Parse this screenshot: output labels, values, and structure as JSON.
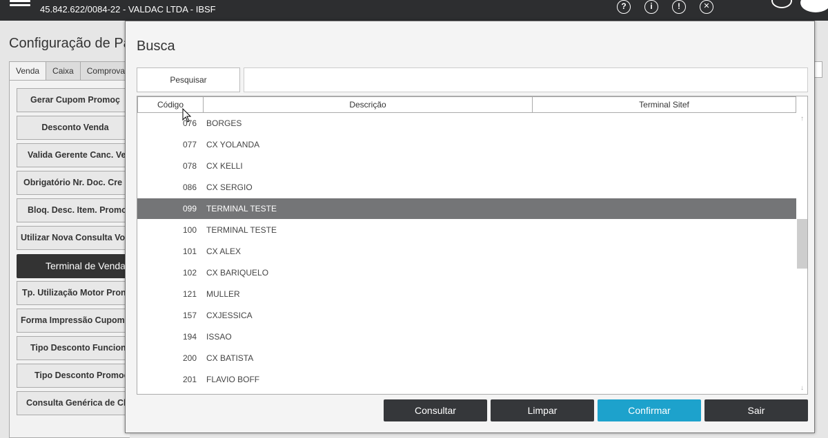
{
  "topbar": {
    "company": "45.842.622/0084-22 - VALDAC LTDA - IBSF",
    "icons": [
      "help-icon",
      "info-icon",
      "alert-icon",
      "close-circle-icon",
      "power-icon",
      "logo-icon"
    ],
    "help_glyph": "?",
    "info_glyph": "i",
    "alert_glyph": "!",
    "close_glyph": "✕"
  },
  "background": {
    "title": "Configuração de Pa",
    "tabs": [
      "Venda",
      "Caixa",
      "Comprova"
    ],
    "buttons": [
      "Gerar Cupom Promoç",
      "Desconto Venda",
      "Valida Gerente Canc. Ve",
      "Obrigatório Nr. Doc. Cre",
      "Bloq. Desc. Item. Promo",
      "Utilizar Nova Consulta Vo",
      "Terminal de Venda",
      "Tp. Utilização Motor Pron",
      "Forma Impressão Cupom",
      "Tipo Desconto Funciona",
      "Tipo Desconto Promoç",
      "Consulta Genérica de Cli"
    ]
  },
  "modal": {
    "title": "Busca",
    "search_button": "Pesquisar",
    "search_value": "",
    "columns": [
      "Código",
      "Descrição",
      "Terminal Sitef"
    ],
    "rows": [
      {
        "code": "076",
        "desc": "BORGES",
        "terminal": ""
      },
      {
        "code": "077",
        "desc": "CX YOLANDA",
        "terminal": ""
      },
      {
        "code": "078",
        "desc": "CX KELLI",
        "terminal": ""
      },
      {
        "code": "086",
        "desc": "CX SERGIO",
        "terminal": ""
      },
      {
        "code": "099",
        "desc": "TERMINAL TESTE",
        "terminal": ""
      },
      {
        "code": "100",
        "desc": "TERMINAL TESTE",
        "terminal": ""
      },
      {
        "code": "101",
        "desc": "CX ALEX",
        "terminal": ""
      },
      {
        "code": "102",
        "desc": "CX BARIQUELO",
        "terminal": ""
      },
      {
        "code": "121",
        "desc": "MULLER",
        "terminal": ""
      },
      {
        "code": "157",
        "desc": "CXJESSICA",
        "terminal": ""
      },
      {
        "code": "194",
        "desc": "ISSAO",
        "terminal": ""
      },
      {
        "code": "200",
        "desc": "CX BATISTA",
        "terminal": ""
      },
      {
        "code": "201",
        "desc": "FLAVIO BOFF",
        "terminal": ""
      }
    ],
    "selected_index": 4,
    "buttons": {
      "consultar": "Consultar",
      "limpar": "Limpar",
      "confirmar": "Confirmar",
      "sair": "Sair"
    }
  },
  "colors": {
    "topbar": "#2d2e30",
    "accent": "#1da2cc",
    "dark_button": "#35373a",
    "selected_row": "#747577"
  }
}
